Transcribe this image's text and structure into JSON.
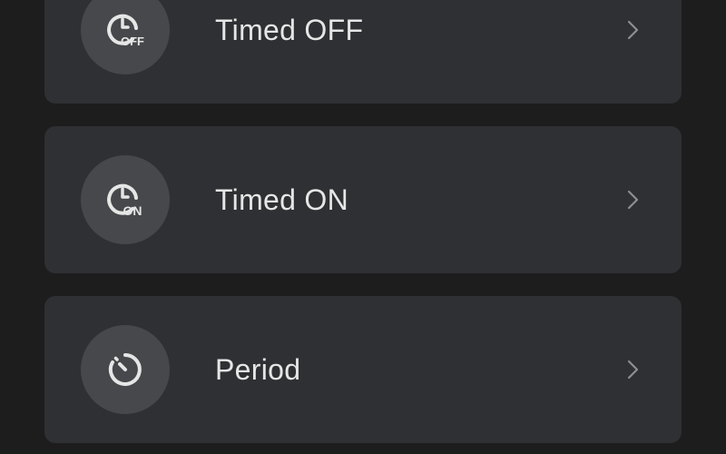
{
  "colors": {
    "background": "#1d1d1e",
    "card": "#2f3033",
    "icon_circle": "#47484b",
    "text": "#e6e6e6",
    "chevron": "#8e8f93"
  },
  "menu": {
    "items": [
      {
        "label": "Timed OFF",
        "icon": "clock-off-icon",
        "badge": "OFF"
      },
      {
        "label": "Timed ON",
        "icon": "clock-on-icon",
        "badge": "ON"
      },
      {
        "label": "Period",
        "icon": "timer-cycle-icon"
      }
    ]
  }
}
